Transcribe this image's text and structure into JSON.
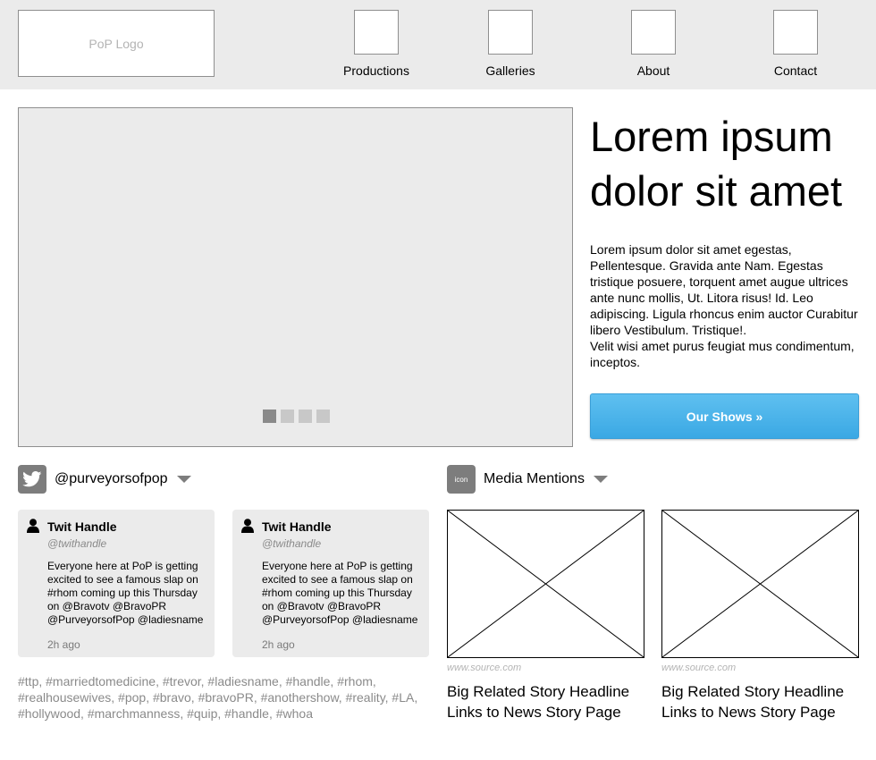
{
  "header": {
    "logo": "PoP Logo",
    "nav": [
      {
        "label": "Productions"
      },
      {
        "label": "Galleries"
      },
      {
        "label": "About"
      },
      {
        "label": "Contact"
      }
    ]
  },
  "hero": {
    "title": "Lorem ipsum dolor sit amet",
    "body_lines": [
      "Lorem ipsum dolor sit amet egestas, Pellentesque. Gravida ante Nam. Egestas tristique posuere, torquent amet augue ultrices ante nunc mollis, Ut. Litora risus! Id. Leo adipiscing. Ligula rhoncus enim auctor Curabitur libero Vestibulum. Tristique!.",
      "Velit wisi amet purus feugiat mus condimentum, inceptos."
    ],
    "cta_label": "Our Shows »",
    "carousel": {
      "count": 4,
      "active": 0
    }
  },
  "twitter": {
    "handle": "@purveyorsofpop",
    "icon": "twitter-bird-icon",
    "tweets": [
      {
        "name": "Twit Handle",
        "handle": "@twithandle",
        "text": "Everyone here at PoP is getting excited to see a famous slap on #rhom coming up this Thursday on @Bravotv @BravoPR @PurveyorsofPop @ladiesname",
        "time": "2h ago"
      },
      {
        "name": "Twit Handle",
        "handle": "@twithandle",
        "text": "Everyone here at PoP is getting excited to see a famous slap on #rhom coming up this Thursday on @Bravotv @BravoPR @PurveyorsofPop @ladiesname",
        "time": "2h ago"
      }
    ],
    "hashtags": "#ttp, #marriedtomedicine, #trevor, #ladiesname, #handle, #rhom, #realhousewives, #pop, #bravo, #bravoPR, #anothershow, #reality, #LA, #hollywood, #marchmanness, #quip, #handle, #whoa"
  },
  "media": {
    "icon_label": "icon",
    "title": "Media Mentions",
    "items": [
      {
        "source": "www.source.com",
        "headline": "Big Related Story Headline Links to News Story Page"
      },
      {
        "source": "www.source.com",
        "headline": "Big Related Story Headline Links to News Story Page"
      }
    ]
  },
  "colors": {
    "header_bg": "#ebebeb",
    "cta": "#4ab4ea",
    "placeholder": "#ebebeb",
    "muted_text": "#8a8a8a"
  }
}
